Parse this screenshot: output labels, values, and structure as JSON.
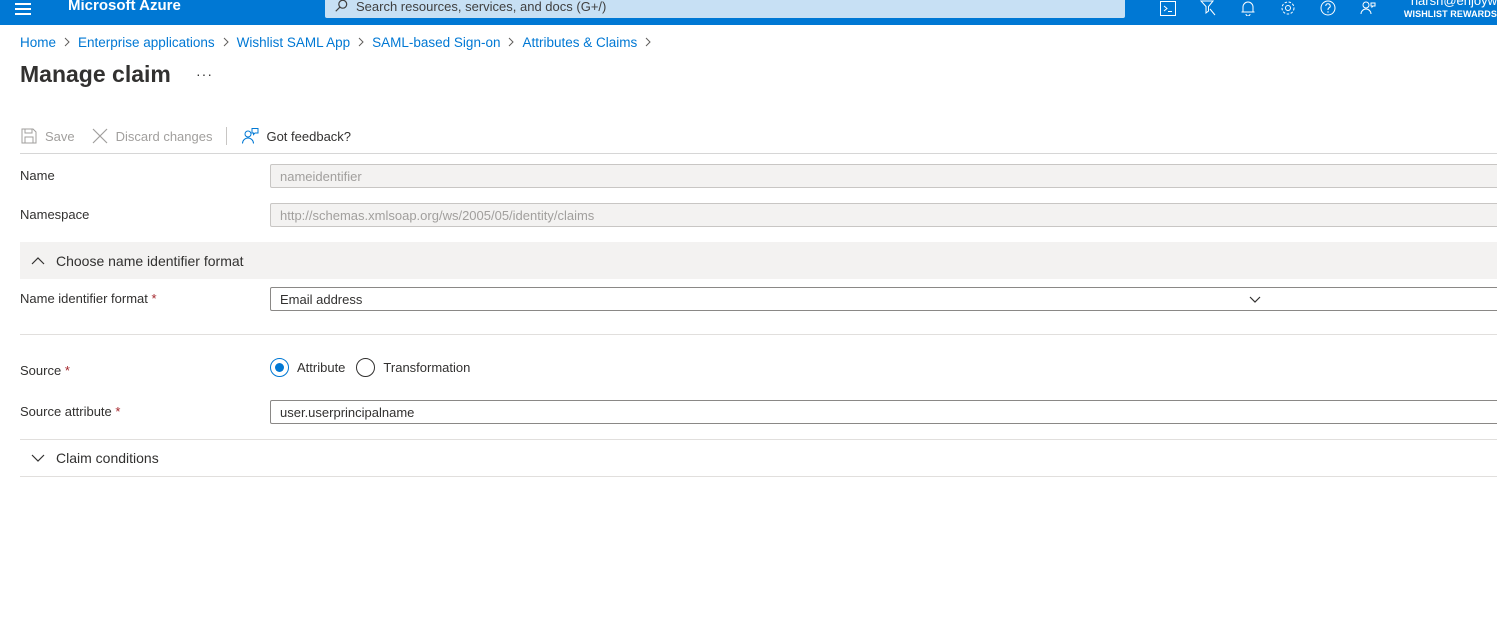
{
  "header": {
    "brand": "Microsoft Azure",
    "search_placeholder": "Search resources, services, and docs (G+/)",
    "icons": [
      "cloud-shell-icon",
      "directory-filter-icon",
      "notifications-icon",
      "settings-icon",
      "help-icon",
      "feedback-icon"
    ],
    "account_user": "harsh@enjoyw",
    "account_tenant": "WISHLIST REWARDS",
    "accent_color": "#0078d4"
  },
  "breadcrumb": [
    "Home",
    "Enterprise applications",
    "Wishlist SAML App",
    "SAML-based Sign-on",
    "Attributes & Claims"
  ],
  "page": {
    "title": "Manage claim",
    "more": "···"
  },
  "toolbar": {
    "save": "Save",
    "discard": "Discard changes",
    "feedback": "Got feedback?"
  },
  "form": {
    "name_label": "Name",
    "name_value": "nameidentifier",
    "namespace_label": "Namespace",
    "namespace_value": "http://schemas.xmlsoap.org/ws/2005/05/identity/claims",
    "format_section": "Choose name identifier format",
    "format_label": "Name identifier format",
    "format_value": "Email address",
    "source_label": "Source",
    "source_options": [
      "Attribute",
      "Transformation"
    ],
    "source_selected": "Attribute",
    "source_attr_label": "Source attribute",
    "source_attr_value": "user.userprincipalname",
    "conditions_section": "Claim conditions",
    "required_mark": "*"
  }
}
